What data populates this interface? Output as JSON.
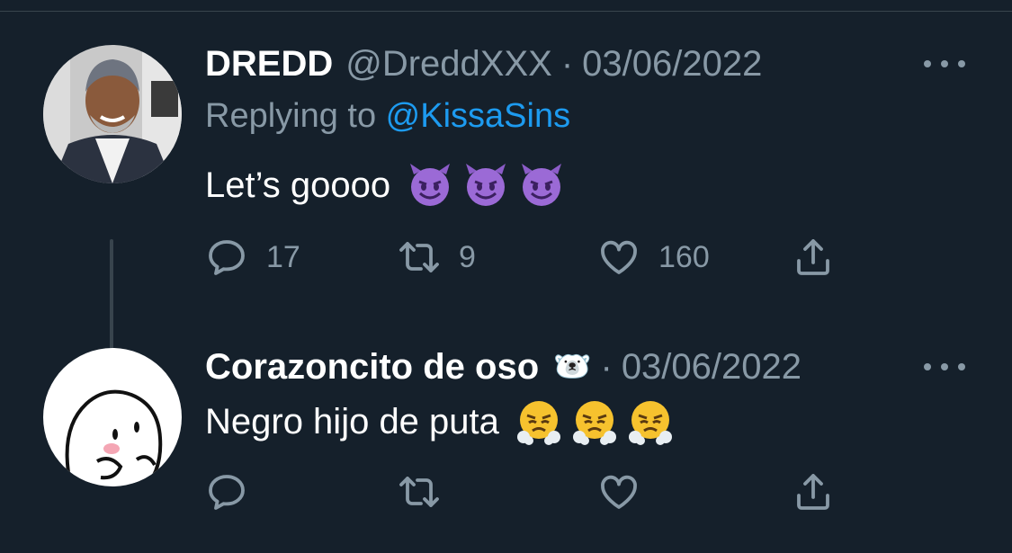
{
  "tweets": [
    {
      "display_name": "DREDD",
      "handle": "@DreddXXX",
      "separator": "·",
      "date": "03/06/2022",
      "replying_prefix": "Replying to ",
      "replying_to": "@KissaSins",
      "text": "Let’s goooo",
      "emojis": [
        "smiling-face-with-horns",
        "smiling-face-with-horns",
        "smiling-face-with-horns"
      ],
      "stats": {
        "replies": "17",
        "retweets": "9",
        "likes": "160"
      }
    },
    {
      "display_name": "Corazoncito de oso",
      "name_emoji": "🐻‍❄️",
      "separator": "·",
      "date": "03/06/2022",
      "text": "Negro hijo de puta",
      "emojis": [
        "face-with-steam-from-nose",
        "face-with-steam-from-nose",
        "face-with-steam-from-nose"
      ],
      "stats": {
        "replies": "",
        "retweets": "",
        "likes": ""
      }
    }
  ],
  "colors": {
    "background": "#15202b",
    "secondary_text": "#8899a6",
    "mention": "#1d9bf0",
    "divider": "#38444d"
  }
}
